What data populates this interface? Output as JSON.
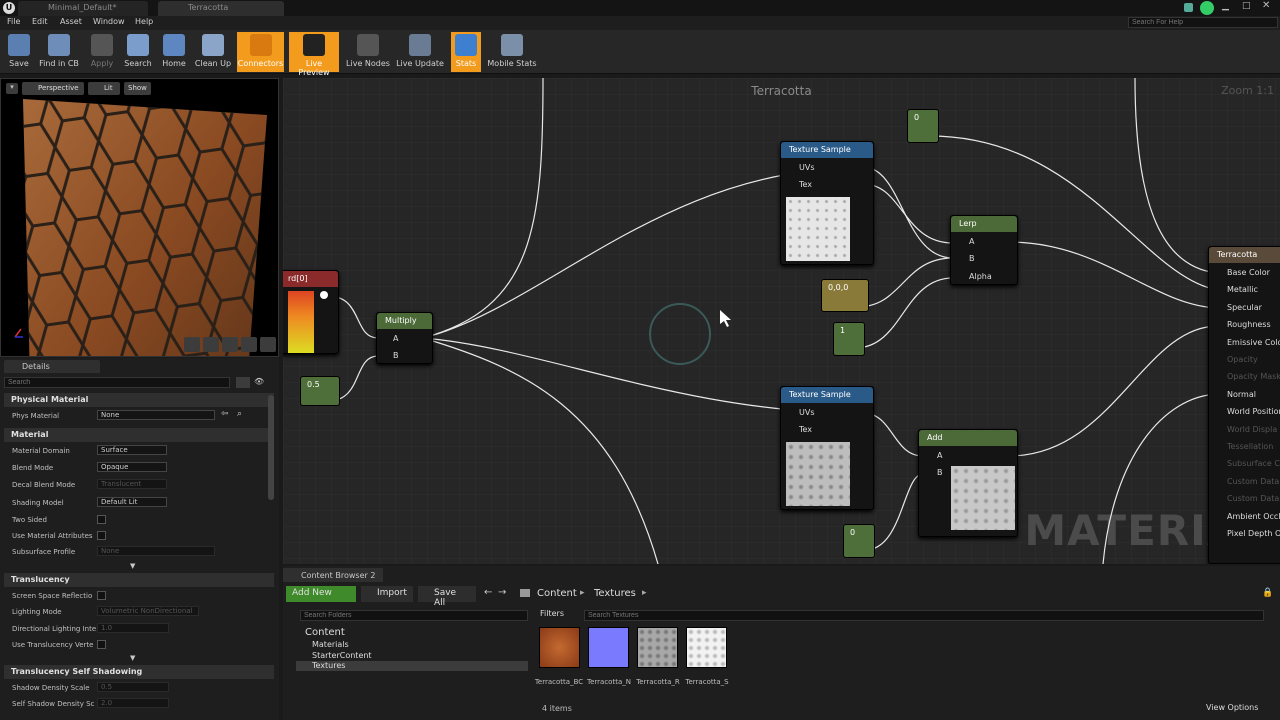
{
  "window": {
    "tabs": [
      "Minimal_Default*",
      "Terracotta"
    ],
    "search_help_placeholder": "Search For Help"
  },
  "menu": [
    "File",
    "Edit",
    "Asset",
    "Window",
    "Help"
  ],
  "toolbar": [
    {
      "label": "Save",
      "icon": "save-icon",
      "active": false
    },
    {
      "label": "Find in CB",
      "icon": "find-icon",
      "active": false
    },
    {
      "label": "Apply",
      "icon": "apply-icon",
      "active": false
    },
    {
      "label": "Search",
      "icon": "search-icon",
      "active": false
    },
    {
      "label": "Home",
      "icon": "home-icon",
      "active": false
    },
    {
      "label": "Clean Up",
      "icon": "cleanup-icon",
      "active": false
    },
    {
      "label": "Connectors",
      "icon": "connectors-icon",
      "active": true
    },
    {
      "label": "Live Preview",
      "icon": "preview-icon",
      "active": true
    },
    {
      "label": "Live Nodes",
      "icon": "nodes-icon",
      "active": false
    },
    {
      "label": "Live Update",
      "icon": "update-icon",
      "active": false
    },
    {
      "label": "Stats",
      "icon": "stats-icon",
      "active": true
    },
    {
      "label": "Mobile Stats",
      "icon": "mobile-icon",
      "active": false
    }
  ],
  "viewport": {
    "buttons": [
      "Perspective",
      "Lit",
      "Show"
    ]
  },
  "details": {
    "tab": "Details",
    "search_placeholder": "Search",
    "sections": {
      "physical": "Physical Material",
      "material": "Material",
      "translucency": "Translucency",
      "self_shadow": "Translucency Self Shadowing"
    },
    "props": {
      "phys_material": {
        "label": "Phys Material",
        "value": "None"
      },
      "domain": {
        "label": "Material Domain",
        "value": "Surface"
      },
      "blend": {
        "label": "Blend Mode",
        "value": "Opaque"
      },
      "decal": {
        "label": "Decal Blend Mode",
        "value": "Translucent"
      },
      "shading": {
        "label": "Shading Model",
        "value": "Default Lit"
      },
      "two_sided": {
        "label": "Two Sided"
      },
      "use_attr": {
        "label": "Use Material Attributes"
      },
      "subsurface": {
        "label": "Subsurface Profile",
        "value": "None"
      },
      "ssr": {
        "label": "Screen Space Reflectio"
      },
      "lighting": {
        "label": "Lighting Mode",
        "value": "Volumetric NonDirectional"
      },
      "dir_light": {
        "label": "Directional Lighting Inte",
        "value": "1.0"
      },
      "use_trans": {
        "label": "Use Translucency Verte"
      },
      "shadow_scale": {
        "label": "Shadow Density Scale",
        "value": "0.5"
      },
      "self_shadow": {
        "label": "Self Shadow Density Sc",
        "value": "2.0"
      }
    }
  },
  "graph": {
    "title": "Terracotta",
    "zoom": "Zoom 1:1",
    "watermark": "MATERIAL",
    "nodes": {
      "coord": "rd[0]",
      "multiply": "Multiply",
      "lerp": "Lerp",
      "add": "Add",
      "ts1": "Texture Sample",
      "ts2": "Texture Sample",
      "output": "Terracotta"
    },
    "consts": {
      "c05": "0.5",
      "c0a": "0",
      "c00": "0,0,0",
      "c1": "1",
      "c0b": "0"
    },
    "pins": {
      "a": "A",
      "b": "B",
      "uvs": "UVs",
      "tex": "Tex",
      "alpha": "Alpha"
    },
    "outputs": [
      "Base Color",
      "Metallic",
      "Specular",
      "Roughness",
      "Emissive Colo",
      "Opacity",
      "Opacity Mask",
      "Normal",
      "World Position",
      "World Displa",
      "Tessellation",
      "Subsurface C",
      "Custom Data",
      "Custom Data",
      "Ambient Occlu",
      "Pixel Depth Of"
    ]
  },
  "content_browser": {
    "tab": "Content Browser 2",
    "add_new": "Add New",
    "import": "Import",
    "save_all": "Save All",
    "path": [
      "Content",
      "Textures"
    ],
    "folders_placeholder": "Search Folders",
    "filters": "Filters",
    "textures_placeholder": "Search Textures",
    "tree": [
      "Content",
      "Materials",
      "StarterContent",
      "Textures"
    ],
    "items": [
      "Terracotta_BC",
      "Terracotta_N",
      "Terracotta_R",
      "Terracotta_S"
    ],
    "count": "4 items",
    "view_options": "View Options"
  }
}
